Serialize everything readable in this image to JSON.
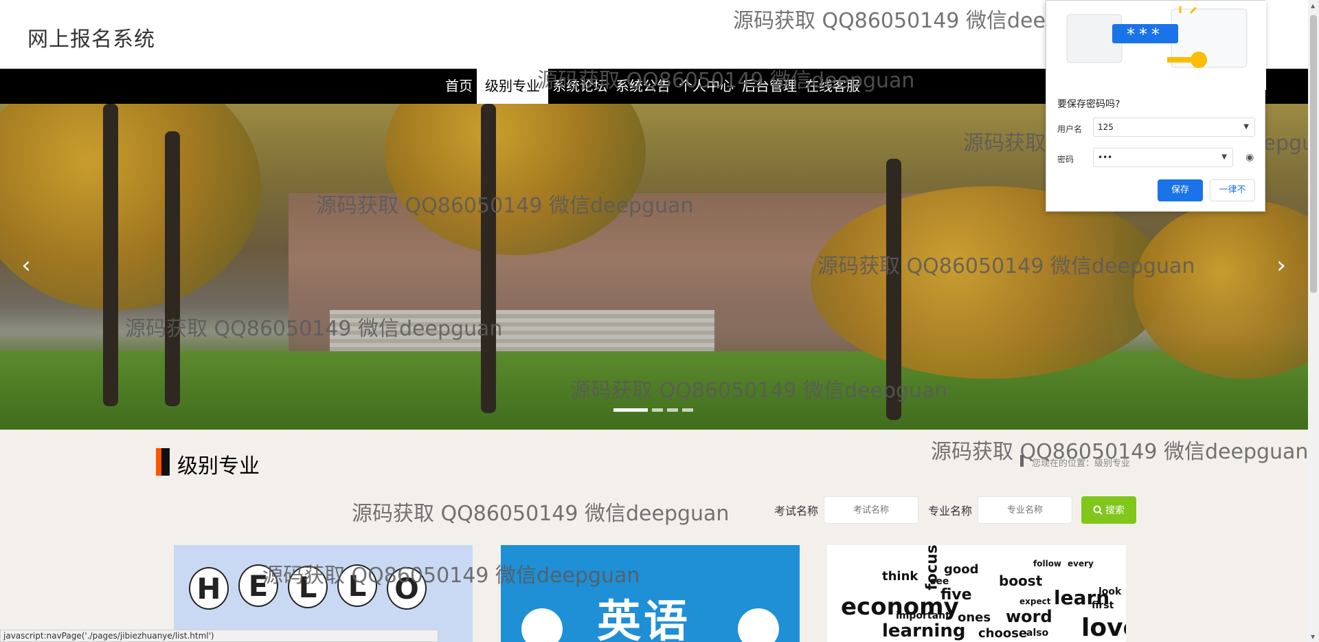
{
  "header": {
    "title": "网上报名系统"
  },
  "nav": {
    "items": [
      {
        "label": "首页"
      },
      {
        "label": "级别专业",
        "active": true
      },
      {
        "label": "系统论坛"
      },
      {
        "label": "系统公告"
      },
      {
        "label": "个人中心"
      },
      {
        "label": "后台管理"
      },
      {
        "label": "在线客服"
      }
    ]
  },
  "banner": {
    "prev_icon": "chevron-left-icon",
    "next_icon": "chevron-right-icon",
    "prev_glyph": "‹",
    "next_glyph": "›",
    "slide_count": 4,
    "active_slide": 1
  },
  "section": {
    "title": "级别专业",
    "breadcrumb": "您现在的位置：级别专业"
  },
  "search": {
    "exam_label": "考试名称",
    "exam_placeholder": "考试名称",
    "major_label": "专业名称",
    "major_placeholder": "专业名称",
    "button_label": "搜索",
    "button_icon": "search-icon",
    "accent": "#80c61b"
  },
  "cards": {
    "card1": {
      "letters": [
        "H",
        "E",
        "L",
        "L",
        "O"
      ]
    },
    "card2": {
      "text": "英语"
    },
    "card3": {
      "words": [
        "economy",
        "focus",
        "word",
        "learning",
        "love",
        "five",
        "choose",
        "learn",
        "good",
        "think",
        "important",
        "boost",
        "look",
        "ones",
        "first",
        "see",
        "expect",
        "every",
        "follow",
        "also"
      ]
    }
  },
  "watermark": "源码获取 QQ86050149 微信deepguan",
  "status_bar": "javascript:navPage('./pages/jibiezhuanye/list.html')",
  "password_popup": {
    "title": "要保存密码吗?",
    "username_label": "用户名",
    "username_value": "125",
    "password_label": "密码",
    "password_value": "•••",
    "save_label": "保存",
    "never_label": "一律不",
    "illustration_mask": "***"
  }
}
